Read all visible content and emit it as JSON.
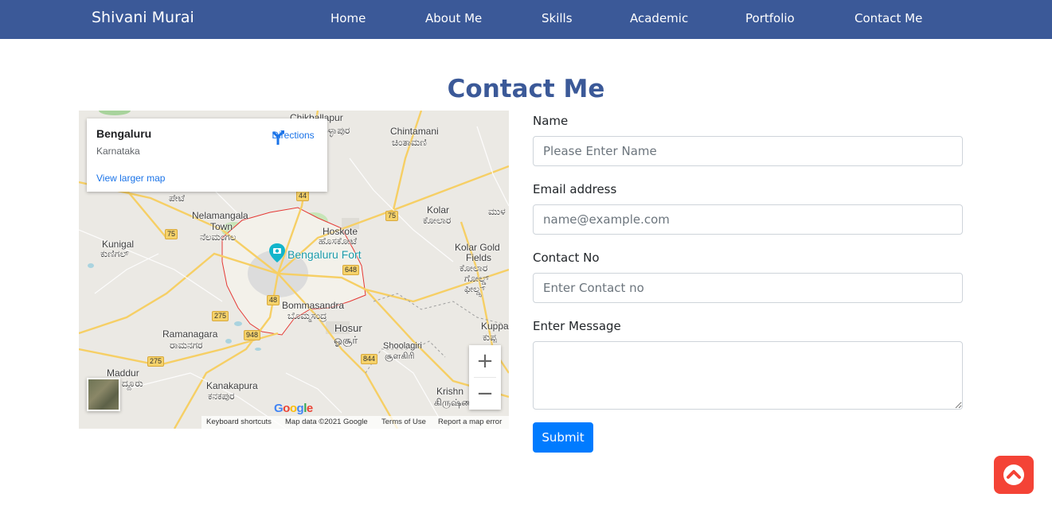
{
  "navbar": {
    "brand": "Shivani Murai",
    "links": [
      {
        "label": "Home"
      },
      {
        "label": "About Me"
      },
      {
        "label": "Skills"
      },
      {
        "label": "Academic"
      },
      {
        "label": "Portfolio"
      },
      {
        "label": "Contact Me"
      }
    ],
    "color": "#3b5998"
  },
  "page_title": "Contact Me",
  "map": {
    "place_name": "Bengaluru",
    "region": "Karnataka",
    "directions_label": "Directions",
    "view_larger": "View larger map",
    "zoom_in": "+",
    "zoom_out": "−",
    "google_logo": "Google",
    "attribution": {
      "keyboard": "Keyboard shortcuts",
      "map_data": "Map data ©2021 Google",
      "terms": "Terms of Use",
      "report": "Report a map error"
    },
    "labels": {
      "chikballapur": "Chikballapur",
      "chikballapur_kn": "ಚಿಕ್ಕಬಳ್ಳಾಪುರ",
      "chintamani": "Chintamani",
      "chintamani_kn": "ಚಿಂತಾಮಣಿ",
      "peti": "ಪೇಟೆ",
      "nelamangala": "Nelamangala",
      "nelamangala_town": "Town",
      "nelamangala_kn": "ನೆಲಮಂಗಲ",
      "kolar": "Kolar",
      "kolar_kn": "ಕೋಲಾರ",
      "mu": "ಮುಳ",
      "hoskote": "Hoskote",
      "hoskote_kn": "ಹೊಸಕೋಟೆ",
      "kunigal": "Kunigal",
      "kunigal_kn": "ಕುಣಿಗಲ್",
      "bengaluru_fort": "Bengaluru Fort",
      "kgf": "Kolar Gold",
      "kgf2": "Fields",
      "kgf_kn1": "ಕೋಲಾರ",
      "kgf_kn2": "ಗೋಲ್ಡ್",
      "kgf_kn3": "ಫೀಲ್ಡ್ಸ್",
      "bommasandra": "Bommasandra",
      "bommasandra_kn": "ಬೊಮ್ಮಸಂದ್ರ",
      "ramanagara": "Ramanagara",
      "ramanagara_kn": "ರಾಮನಗರ",
      "hosur": "Hosur",
      "hosur_ta": "ஓசூர்",
      "kuppam": "Kuppa",
      "kuppam_kn": "ಕುಪ್ಪ",
      "shoolagiri": "Shoolagiri",
      "shoolagiri_ta": "சூளகிரி",
      "maddur": "Maddur",
      "maddur_kn": "ದ್ದೂರು",
      "kanakapura": "Kanakapura",
      "kanakapura_kn": "ಕನಕಪುರ",
      "krishnagiri": "Krishn",
      "krishnagiri_ta": "கிருஷ்ண"
    },
    "shields": {
      "s44": "44",
      "s75a": "75",
      "s75b": "75",
      "s648": "648",
      "s48": "48",
      "s275a": "275",
      "s948": "948",
      "s844": "844",
      "s275b": "275"
    }
  },
  "form": {
    "name_label": "Name",
    "name_placeholder": "Please Enter Name",
    "email_label": "Email address",
    "email_placeholder": "name@example.com",
    "contact_label": "Contact No",
    "contact_placeholder": "Enter Contact no",
    "message_label": "Enter Message",
    "submit_label": "Submit"
  },
  "scroll_top": {
    "icon": "chevron-up-icon",
    "color": "#f44336"
  }
}
